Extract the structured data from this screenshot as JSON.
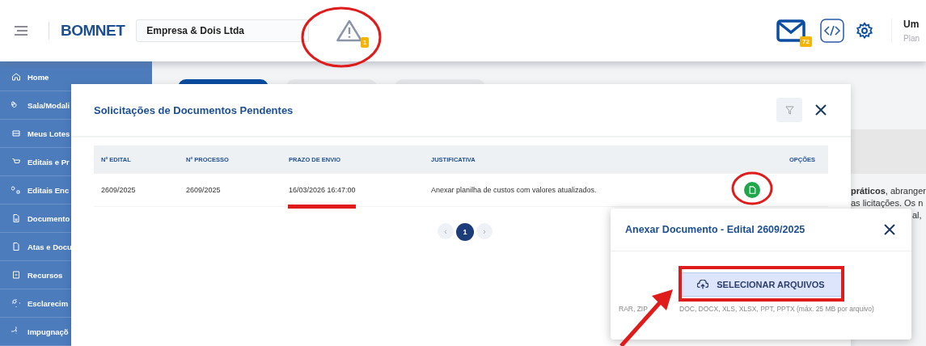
{
  "header": {
    "logo": "BOMNET",
    "company": "Empresa & Dois Ltda",
    "alert_badge": "1",
    "mail_badge": "72",
    "user": {
      "name": "Um",
      "plan": "Plan"
    }
  },
  "sidebar": {
    "items": [
      {
        "label": "Home"
      },
      {
        "label": "Sala/Modali"
      },
      {
        "label": "Meus Lotes"
      },
      {
        "label": "Editais e Pr"
      },
      {
        "label": "Editais Enc"
      },
      {
        "label": "Documento"
      },
      {
        "label": "Atas e Docu"
      },
      {
        "label": "Recursos"
      },
      {
        "label": "Esclarecim"
      },
      {
        "label": "Impugnaçõ"
      }
    ]
  },
  "background_text": [
    "**práticos**, abranger",
    "as licitações. Os n",
    "al,"
  ],
  "pending_dialog": {
    "title": "Solicitações de Documentos Pendentes",
    "columns": [
      "Nº EDITAL",
      "Nº PROCESSO",
      "PRAZO DE ENVIO",
      "JUSTIFICATIVA",
      "OPÇÕES"
    ],
    "rows": [
      {
        "cells": [
          "2609/2025",
          "2609/2025",
          "16/03/2026 16:47:00",
          "Anexar planilha de custos com valores atualizados."
        ]
      }
    ],
    "prev": "‹",
    "next": "›",
    "pages": [
      {
        "label": "1",
        "selected": true
      }
    ]
  },
  "upload_dialog": {
    "title": "Anexar Documento - Edital 2609/2025",
    "button": "SELECIONAR ARQUIVOS",
    "hint_parts": [
      "RAR, ZIP",
      "DOC, DOCX, XLS, XLSX, PPT, PPTX (máx. 25 MB por arquivo)"
    ]
  },
  "annotations": [
    {
      "kind": "ellipse"
    },
    {
      "kind": "underline"
    },
    {
      "kind": "ellipse"
    },
    {
      "kind": "rectangle"
    },
    {
      "kind": "arrow"
    }
  ]
}
